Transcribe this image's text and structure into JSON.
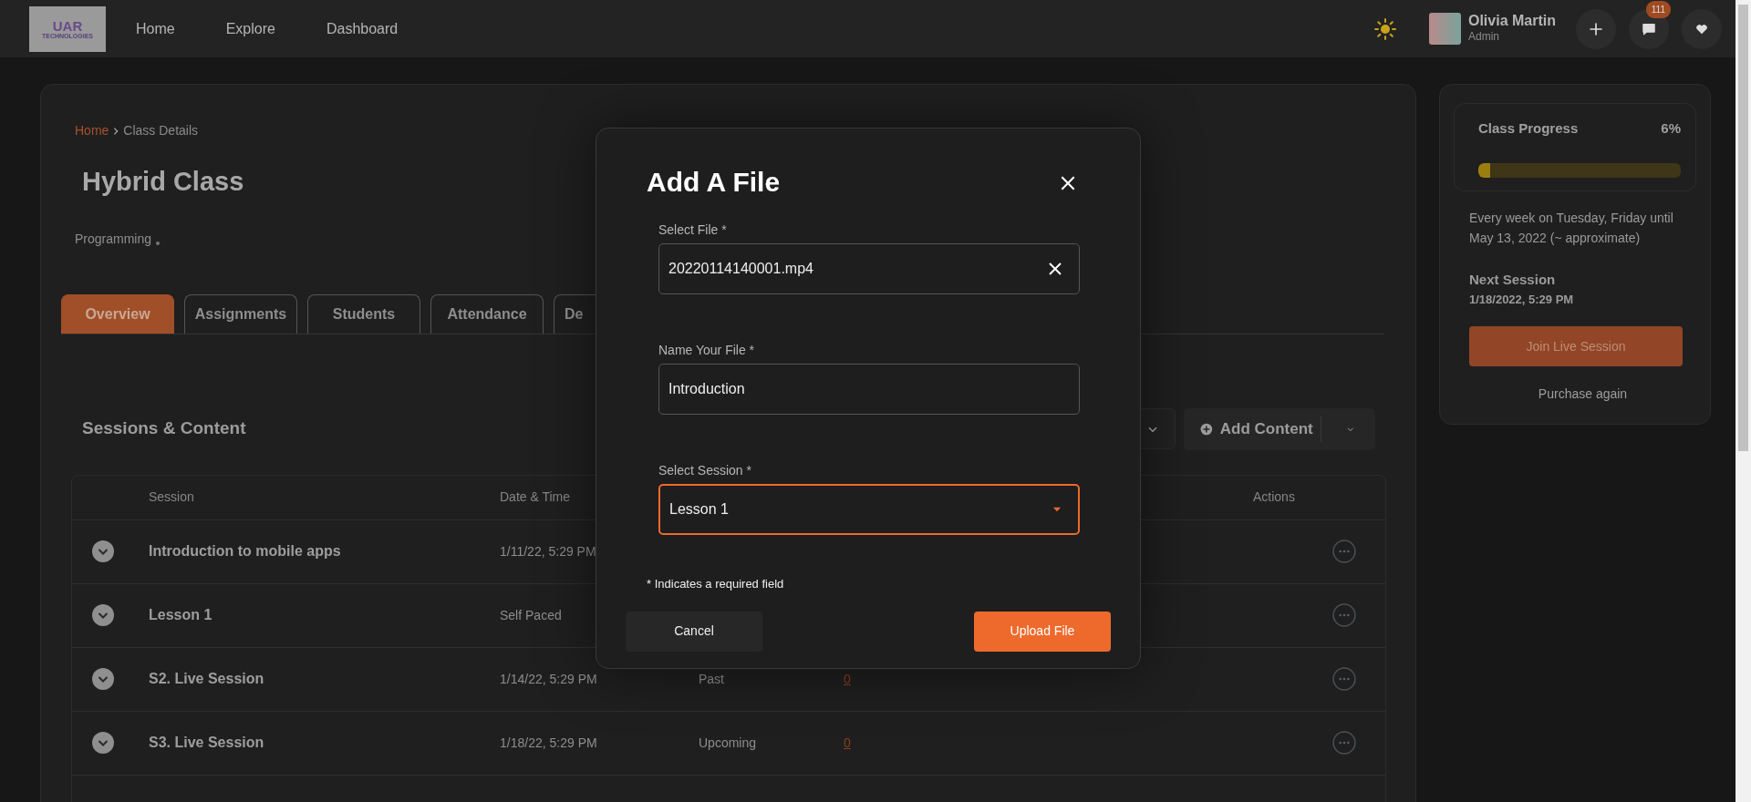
{
  "nav": {
    "logo": [
      "UAR",
      "TECHNOLOGIES"
    ],
    "links": [
      {
        "label": "Home"
      },
      {
        "label": "Explore"
      },
      {
        "label": "Dashboard"
      }
    ],
    "user": {
      "name": "Olivia Martin",
      "role": "Admin"
    },
    "notifications": "111"
  },
  "breadcrumb": [
    {
      "label": "Home",
      "kind": "link"
    },
    {
      "label": "Class Details",
      "kind": "current"
    }
  ],
  "title": "Hybrid Class",
  "category": "Programming",
  "tabs": [
    {
      "label": "Overview",
      "selected": true
    },
    {
      "label": "Assignments",
      "selected": false
    },
    {
      "label": "Students",
      "selected": false
    },
    {
      "label": "Attendance",
      "selected": false
    },
    {
      "label": "De",
      "selected": false
    }
  ],
  "sessions": {
    "title": "Sessions & Content",
    "add_button": "Add Content",
    "columns": [
      "Session",
      "Date & Time",
      "Actions"
    ],
    "rows": [
      {
        "name": "Introduction to mobile apps",
        "date": "1/11/22, 5:29 PM"
      },
      {
        "name": "Lesson 1",
        "date": "Self Paced"
      },
      {
        "name": "S2. Live Session",
        "date": "1/14/22, 5:29 PM",
        "status": "Past",
        "count": "0"
      },
      {
        "name": "S3. Live Session",
        "date": "1/18/22, 5:29 PM",
        "status": "Upcoming",
        "count": "0"
      }
    ]
  },
  "side": {
    "progress_title": "Class Progress",
    "percent": "6%",
    "level": 0.06,
    "schedule": "Every week on Tuesday, Friday until May 13, 2022 (~ approximate)",
    "next_label": "Next Session",
    "next_date": "1/18/2022, 5:29 PM",
    "join_button": "Join Live Session",
    "purchase_link": "Purchase again"
  },
  "modal": {
    "title": "Add A File",
    "fields": [
      {
        "kind": "file",
        "label": "Select File *",
        "value": "20220114140001.mp4",
        "focused": false
      },
      {
        "kind": "text",
        "label": "Name Your File *",
        "value": "Introduction",
        "focused": false
      },
      {
        "kind": "select",
        "label": "Select Session *",
        "value": "Lesson 1",
        "focused": true
      }
    ],
    "note": "* Indicates a required field",
    "cancel": "Cancel",
    "submit": "Upload File"
  }
}
